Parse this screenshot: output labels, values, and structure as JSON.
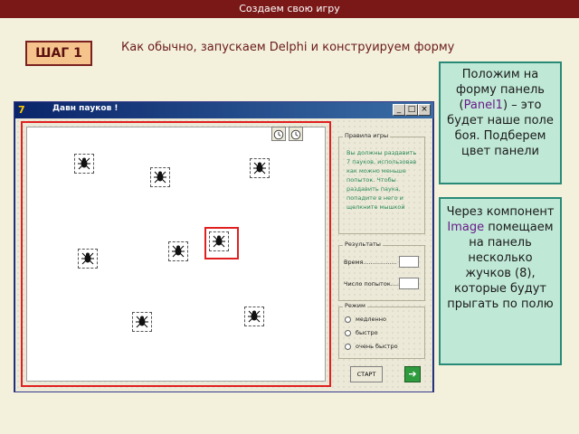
{
  "slide": {
    "header": "Создаем свою игру",
    "step": "ШАГ 1",
    "subtitle": "Как обычно, запускаем Delphi и конструируем форму"
  },
  "window": {
    "icon": "7",
    "title": "Давн пауков !",
    "buttons": [
      "_",
      "□",
      "×"
    ]
  },
  "rules": {
    "title": "Правила игры",
    "text": "Вы должны раздавить 7 пауков, использовав как можно меньше попыток. Чтобы раздавить паука, попадите в него и щелкните мышкой"
  },
  "results": {
    "title": "Результаты",
    "time_label": "Время..................",
    "attempts_label": "Число попыток......"
  },
  "mode": {
    "title": "Режим",
    "options": [
      "медленно",
      "быстро",
      "очень быстро"
    ]
  },
  "start_button": "СТАРТ",
  "callouts": {
    "first_pre": "Положим на форму панель (",
    "first_highlight": "Panel1",
    "first_post": ") – это будет наше поле боя. Подберем цвет панели",
    "second_pre": "Через компонент ",
    "second_highlight": "Image",
    "second_post": " помещаем на панель несколько жучков (8), которые будут прыгать по полю"
  },
  "colors": {
    "header_bg": "#7a1717",
    "callout_bg": "#bfe8d6",
    "highlight_red": "#e02020",
    "rules_text": "#2a8a5a"
  }
}
